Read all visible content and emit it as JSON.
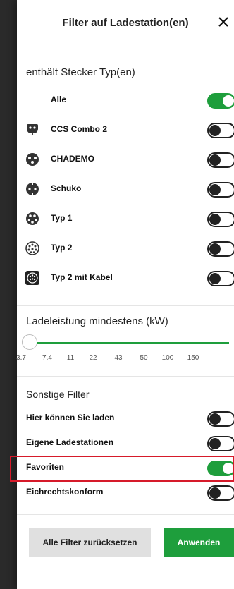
{
  "header": {
    "title": "Filter auf Ladestation(en)"
  },
  "plugs": {
    "title": "enthält Stecker Typ(en)",
    "items": [
      {
        "label": "Alle",
        "on": true,
        "icon": ""
      },
      {
        "label": "CCS Combo 2",
        "on": false,
        "icon": "ccs-combo-2-icon"
      },
      {
        "label": "CHADEMO",
        "on": false,
        "icon": "chademo-icon"
      },
      {
        "label": "Schuko",
        "on": false,
        "icon": "schuko-icon"
      },
      {
        "label": "Typ 1",
        "on": false,
        "icon": "typ-1-icon"
      },
      {
        "label": "Typ 2",
        "on": false,
        "icon": "typ-2-icon"
      },
      {
        "label": "Typ 2 mit Kabel",
        "on": false,
        "icon": "typ-2-mit-kabel-icon"
      }
    ]
  },
  "power": {
    "title": "Ladeleistung mindestens (kW)",
    "ticks": [
      "3.7",
      "7.4",
      "11",
      "22",
      "43",
      "50",
      "100",
      "150"
    ],
    "selected": "3.7"
  },
  "other": {
    "title": "Sonstige Filter",
    "items": [
      {
        "label": "Hier können Sie laden",
        "on": false
      },
      {
        "label": "Eigene Ladestationen",
        "on": false
      },
      {
        "label": "Favoriten",
        "on": true
      },
      {
        "label": "Eichrechtskonform",
        "on": false
      }
    ]
  },
  "footer": {
    "reset_label": "Alle Filter zurücksetzen",
    "apply_label": "Anwenden"
  },
  "colors": {
    "accent": "#1e9e3c",
    "highlight": "#d61a2a"
  }
}
